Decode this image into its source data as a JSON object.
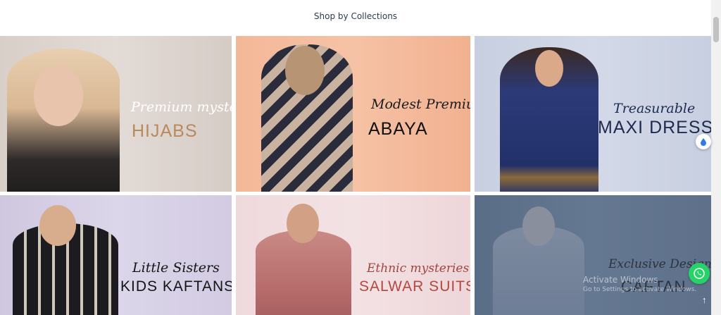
{
  "section": {
    "title": "Shop by Collections"
  },
  "collections": [
    {
      "subtitle": "Premium mysteries",
      "title": "HIJABS"
    },
    {
      "subtitle": "Modest Premium",
      "title": "ABAYA"
    },
    {
      "subtitle": "Treasurable",
      "title": "MAXI DRESS"
    },
    {
      "subtitle": "Little Sisters",
      "title": "KIDS KAFTANS"
    },
    {
      "subtitle": "Ethnic mysteries",
      "title": "SALWAR SUITS"
    },
    {
      "subtitle": "Exclusive Designer",
      "title": "CAFTAN"
    }
  ],
  "windows_watermark": {
    "line1": "Activate Windows",
    "line2": "Go to Settings to activate Windows."
  },
  "icons": {
    "side_widget": "water-drop-icon",
    "chat": "whatsapp-icon",
    "scroll_top": "arrow-up-icon"
  },
  "colors": {
    "title_text": "#2b3d4f",
    "whatsapp": "#25d366"
  }
}
